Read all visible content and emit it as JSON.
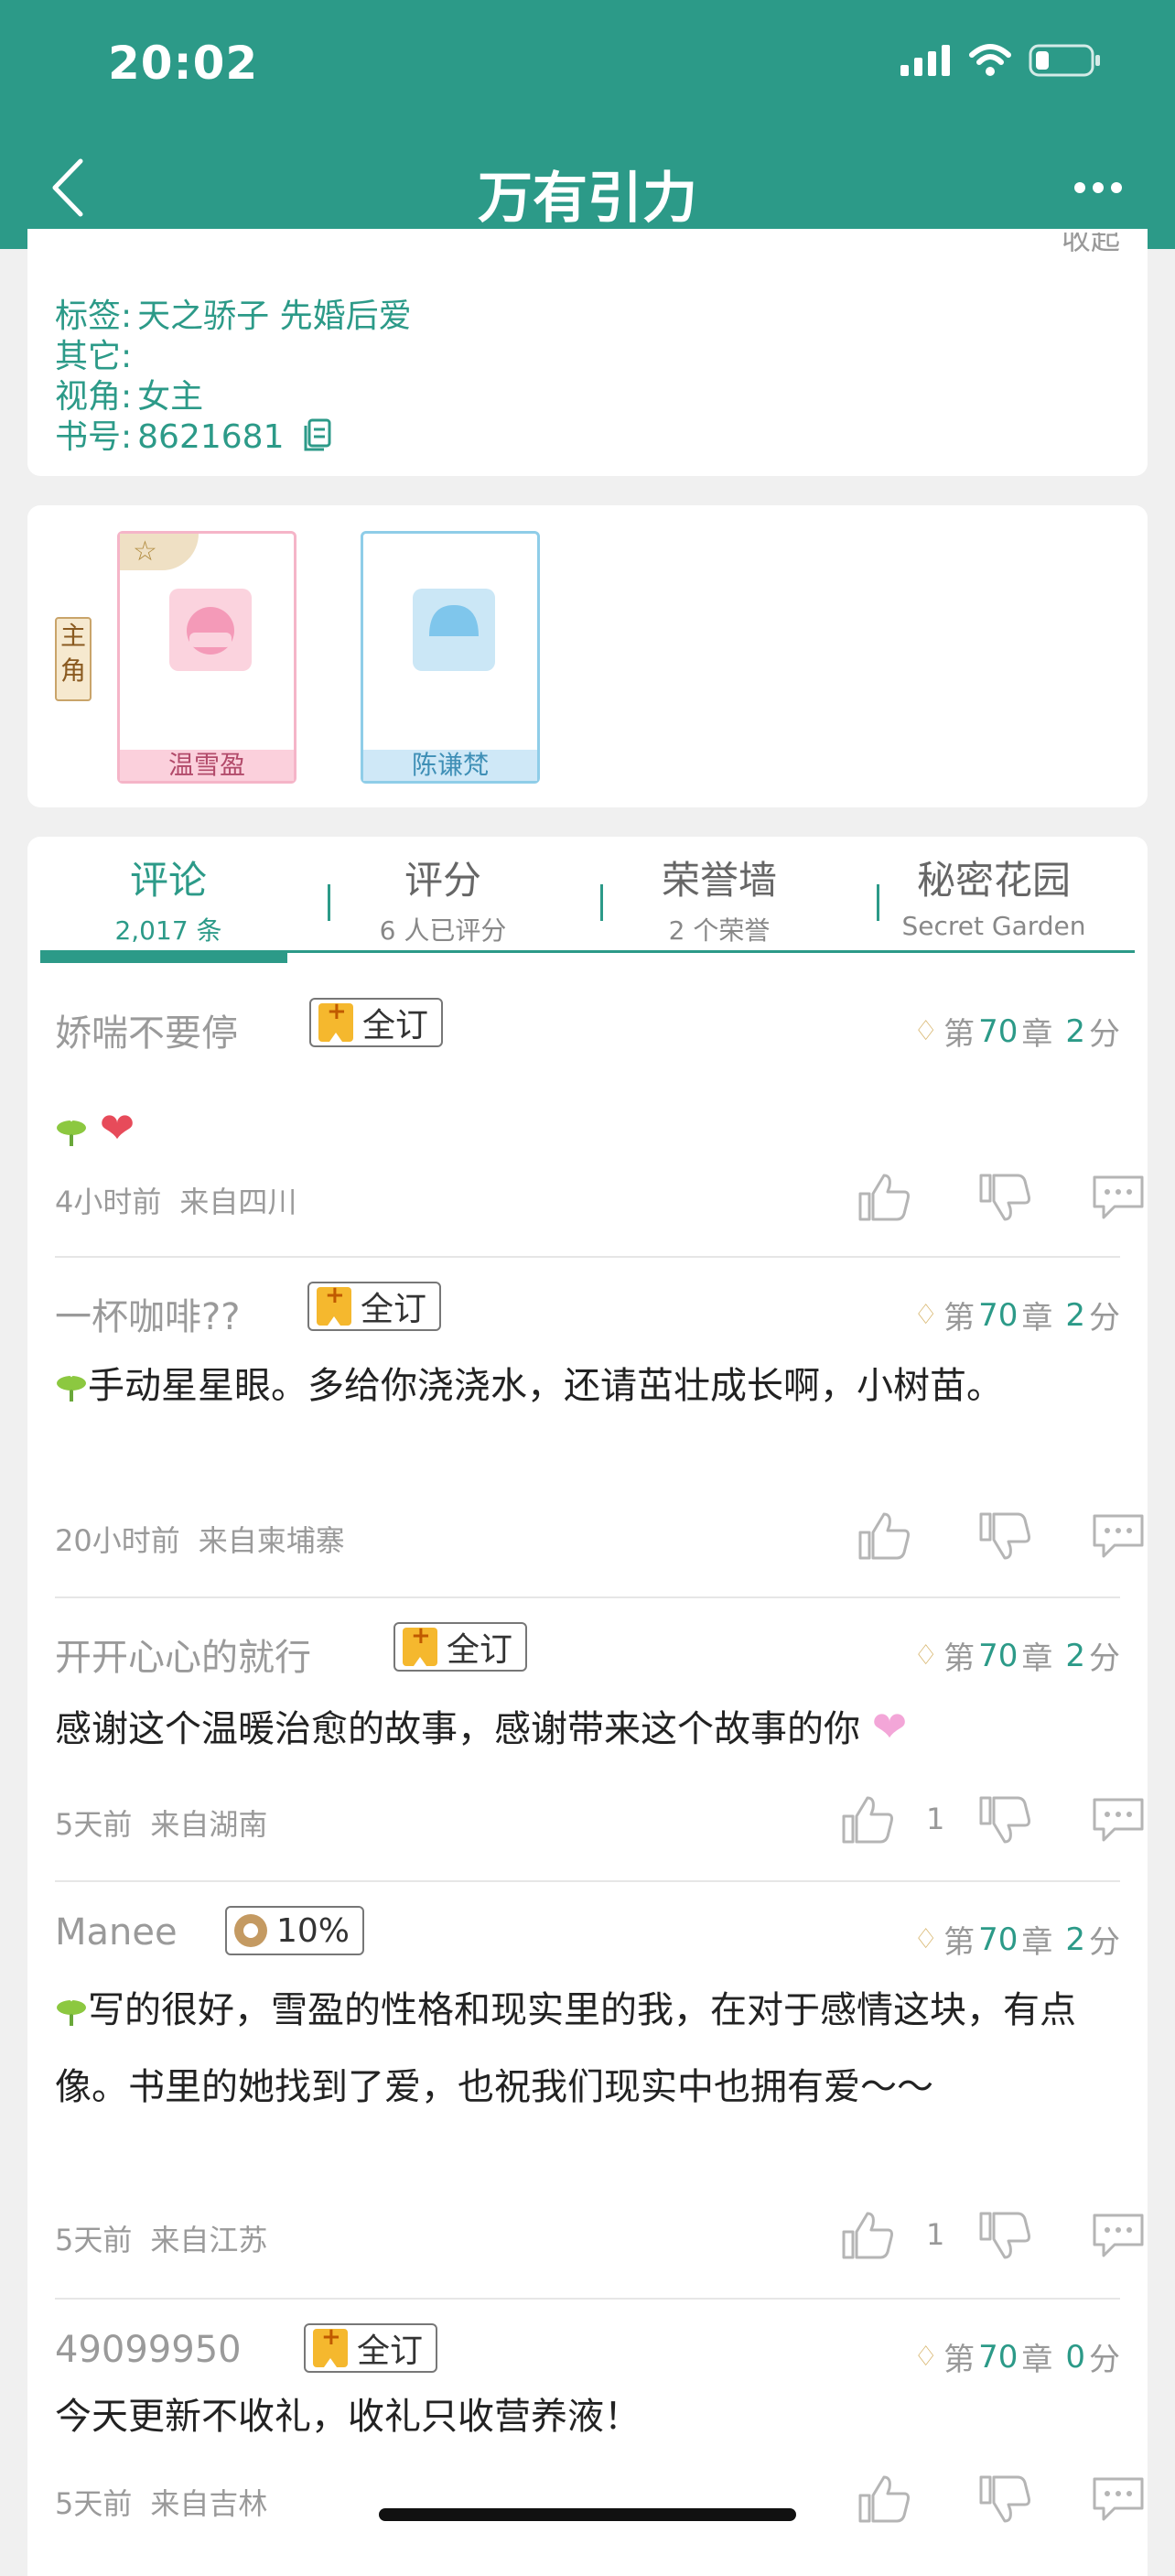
{
  "status": {
    "time": "20:02"
  },
  "nav": {
    "title": "万有引力"
  },
  "colors": {
    "accent": "#2c9a88",
    "vip_gold": "#d7b46a",
    "like_gray": "#b5b5b5"
  },
  "info": {
    "peek": "收起",
    "tags": {
      "key": "标签:",
      "value": "天之骄子  先婚后爱"
    },
    "other": {
      "key": "其它:",
      "value": ""
    },
    "pov": {
      "key": "视角:",
      "value": "女主"
    },
    "book_id": {
      "key": "书号:",
      "value": "8621681"
    }
  },
  "characters": {
    "role_label_1": "主",
    "role_label_2": "角",
    "items": [
      {
        "name": "温雪盈"
      },
      {
        "name": "陈谦梵"
      }
    ]
  },
  "tabs": [
    {
      "label": "评论",
      "sub": "2,017 条"
    },
    {
      "label": "评分",
      "sub": "6 人已评分"
    },
    {
      "label": "荣誉墙",
      "sub": "2 个荣誉"
    },
    {
      "label": "秘密花园",
      "sub": "Secret Garden"
    }
  ],
  "comments": [
    {
      "user": "娇喘不要停",
      "badge": "全订",
      "chapter_pre": "第",
      "chapter": "70",
      "chapter_mid": "章",
      "score": "2",
      "score_unit": "分",
      "text": "",
      "time": "4小时前",
      "location": "来自四川",
      "likes": ""
    },
    {
      "user": "一杯咖啡??",
      "badge": "全订",
      "chapter_pre": "第",
      "chapter": "70",
      "chapter_mid": "章",
      "score": "2",
      "score_unit": "分",
      "text": "手动星星眼。多给你浇浇水，还请茁壮成长啊，小树苗。",
      "time": "20小时前",
      "location": "来自柬埔寨",
      "likes": ""
    },
    {
      "user": "开开心心的就行",
      "badge": "全订",
      "chapter_pre": "第",
      "chapter": "70",
      "chapter_mid": "章",
      "score": "2",
      "score_unit": "分",
      "text": "感谢这个温暖治愈的故事，感谢带来这个故事的你",
      "time": "5天前",
      "location": "来自湖南",
      "likes": "1"
    },
    {
      "user": "Manee",
      "badge": "10%",
      "chapter_pre": "第",
      "chapter": "70",
      "chapter_mid": "章",
      "score": "2",
      "score_unit": "分",
      "text": "写的很好，雪盈的性格和现实里的我，在对于感情这块，有点像。书里的她找到了爱，也祝我们现实中也拥有爱～～",
      "time": "5天前",
      "location": "来自江苏",
      "likes": "1"
    },
    {
      "user": "49099950",
      "badge": "全订",
      "chapter_pre": "第",
      "chapter": "70",
      "chapter_mid": "章",
      "score": "0",
      "score_unit": "分",
      "text": "今天更新不收礼，收礼只收营养液！",
      "time": "5天前",
      "location": "来自吉林",
      "likes": ""
    }
  ]
}
